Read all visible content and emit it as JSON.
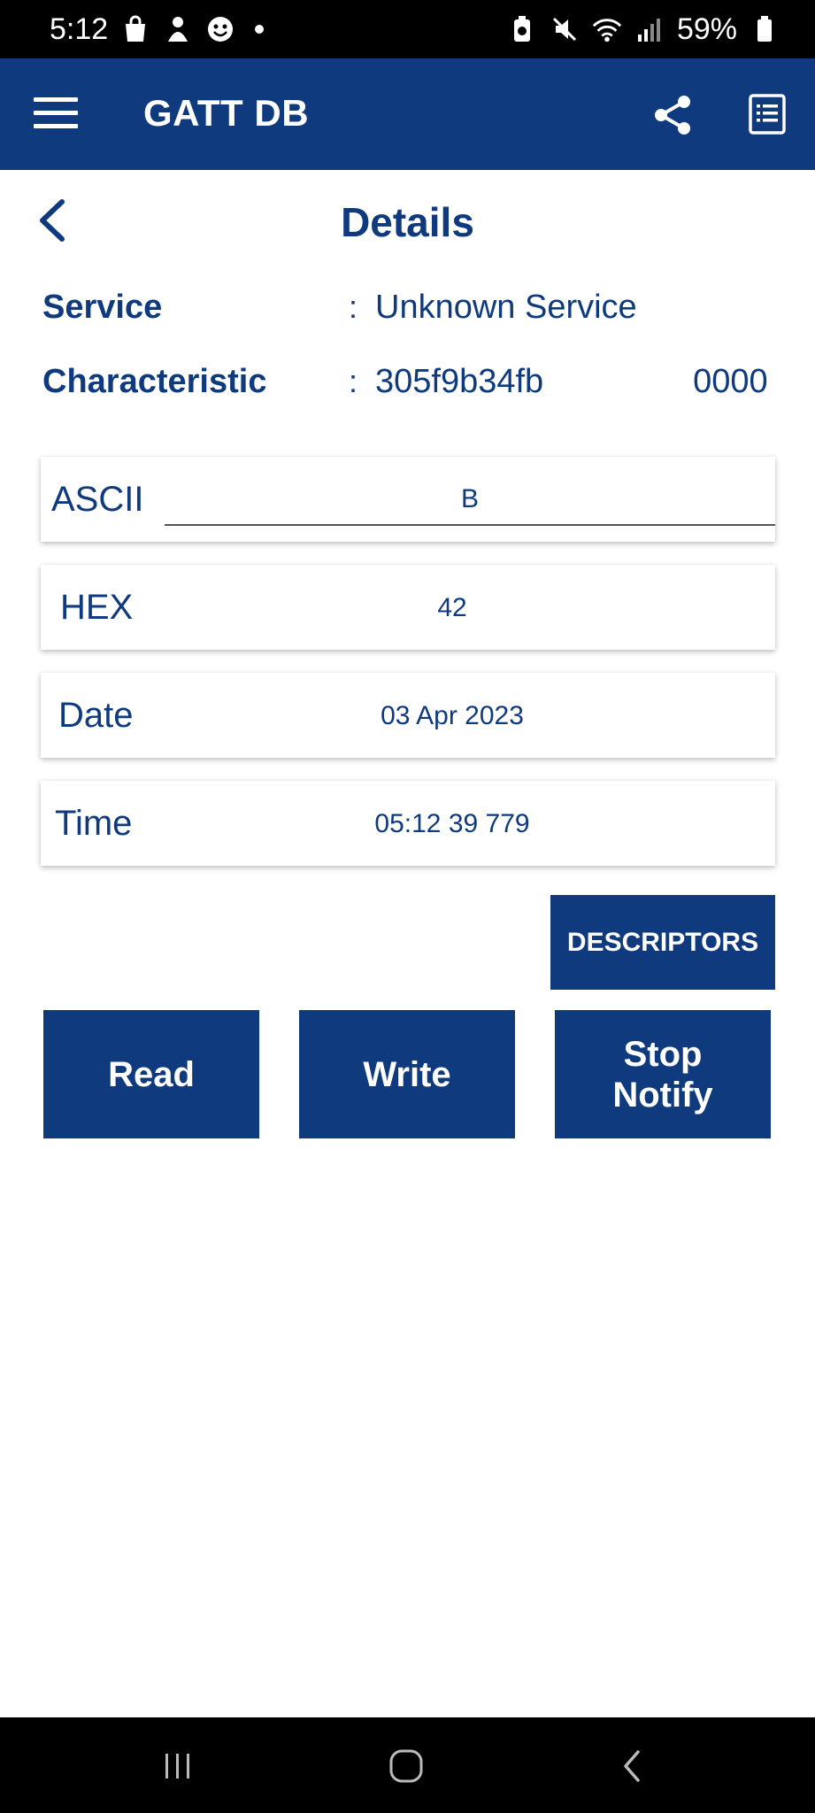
{
  "status_bar": {
    "time": "5:12",
    "battery": "59%"
  },
  "app_bar": {
    "title": "GATT DB"
  },
  "details": {
    "title": "Details",
    "service_label": "Service",
    "service_value": "Unknown Service",
    "characteristic_label": "Characteristic",
    "characteristic_value": "305f9b34fb                0000",
    "colon": ":"
  },
  "cards": {
    "ascii_label": "ASCII",
    "ascii_value": "B",
    "hex_label": "HEX",
    "hex_value": "42",
    "date_label": "Date",
    "date_value": "03 Apr 2023",
    "time_label": "Time",
    "time_value": "05:12 39 779"
  },
  "buttons": {
    "descriptors": "DESCRIPTORS",
    "read": "Read",
    "write": "Write",
    "stop_notify": "Stop Notify"
  },
  "colors": {
    "primary": "#0f3a7d",
    "status_bar": "#000000",
    "background": "#ffffff"
  },
  "icons": {
    "menu": "hamburger-menu-icon",
    "share": "share-icon",
    "log": "list-log-icon",
    "back": "chevron-left-icon"
  }
}
